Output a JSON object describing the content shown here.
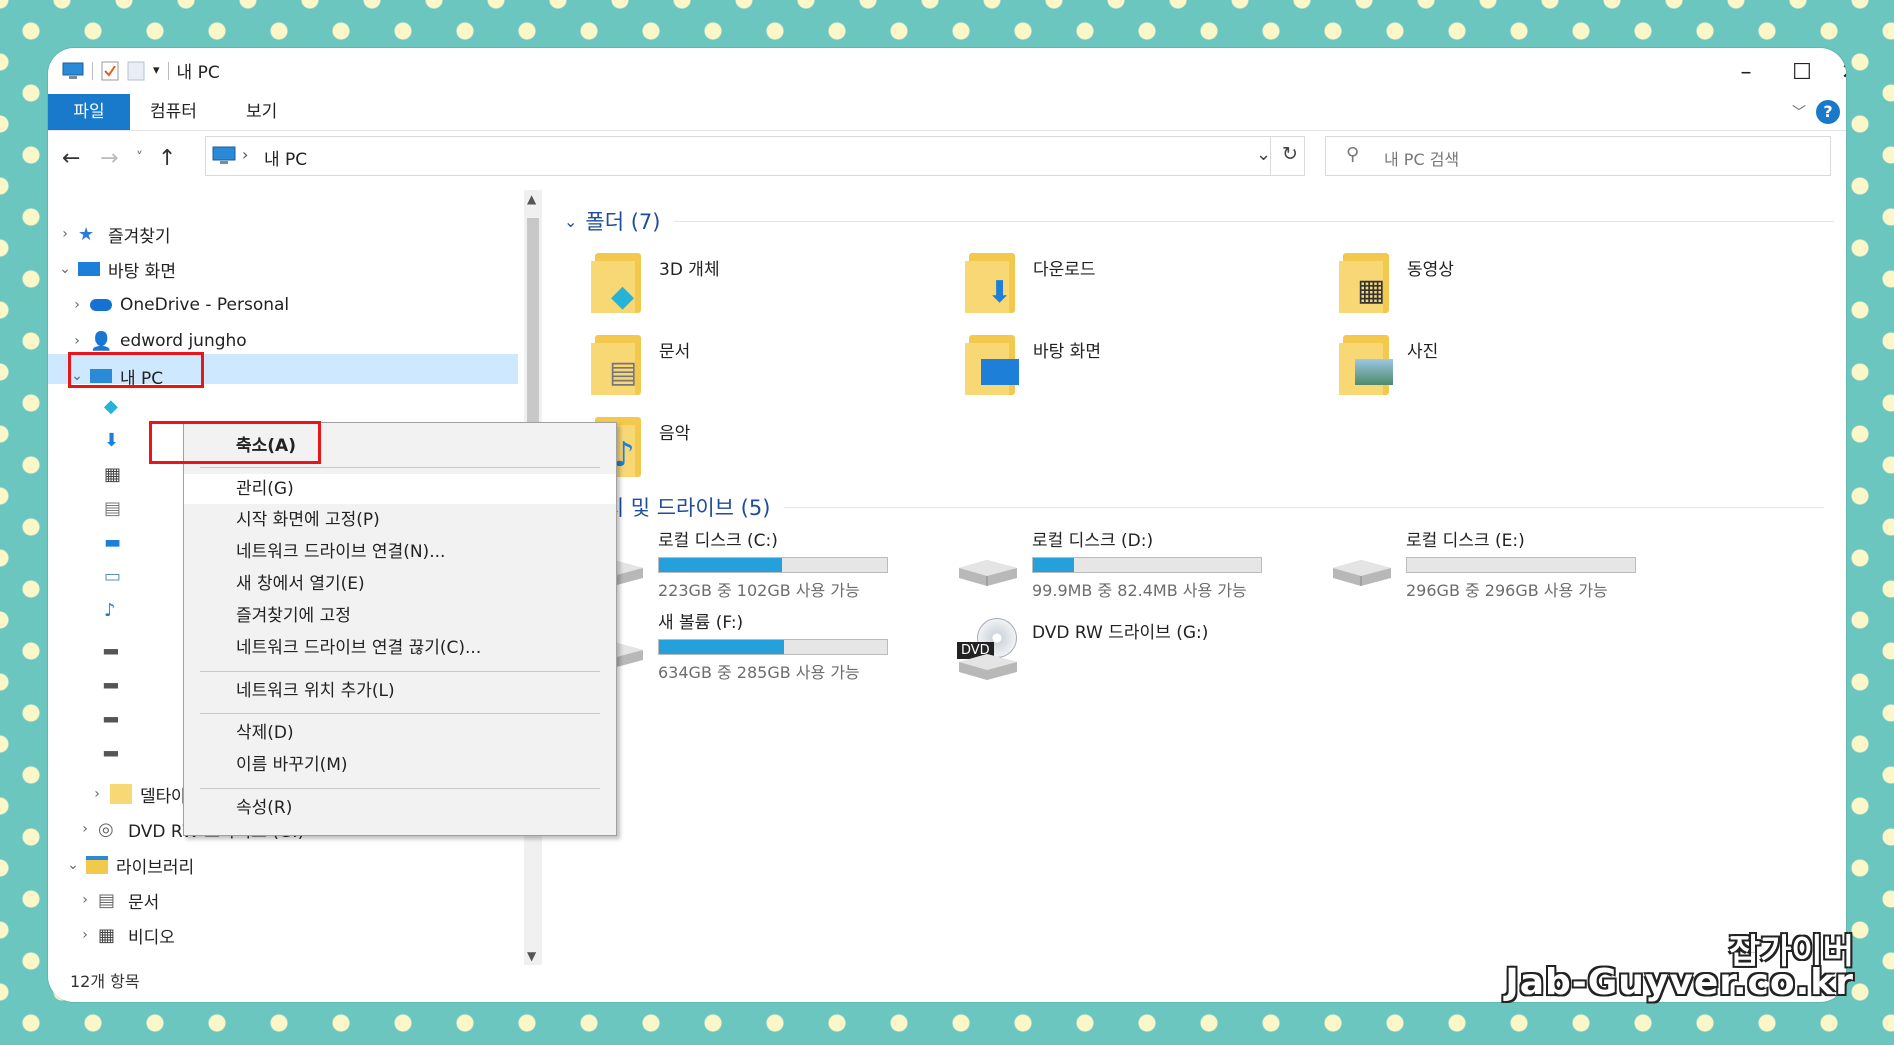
{
  "window": {
    "title": "내 PC"
  },
  "ribbon": {
    "tabs": [
      "파일",
      "컴퓨터",
      "보기"
    ]
  },
  "nav": {
    "address": "내 PC",
    "search_placeholder": "내 PC 검색"
  },
  "tree": {
    "top_items": [
      {
        "label": "즐겨찾기",
        "expanded": false
      },
      {
        "label": "바탕 화면",
        "expanded": true
      },
      {
        "label": "OneDrive - Personal",
        "expanded": false
      },
      {
        "label": "edword jungho",
        "expanded": false
      },
      {
        "label": "내 PC",
        "expanded": true
      }
    ],
    "bottom_items": [
      {
        "label": "델타아이티"
      },
      {
        "label": "DVD RW 드라이브 (G:)"
      },
      {
        "label": "라이브러리"
      },
      {
        "label": "문서"
      },
      {
        "label": "비디오"
      }
    ]
  },
  "status": {
    "count": "12개 항목"
  },
  "folders": {
    "header": "폴더 (7)",
    "items": [
      "3D 개체",
      "다운로드",
      "동영상",
      "문서",
      "바탕 화면",
      "사진",
      "음악"
    ]
  },
  "drives": {
    "header": "장치 및 드라이브 (5)",
    "items": [
      {
        "name": "로컬 디스크 (C:)",
        "free": "223GB 중 102GB 사용 가능",
        "used_fraction": 0.54
      },
      {
        "name": "로컬 디스크 (D:)",
        "free": "99.9MB 중 82.4MB 사용 가능",
        "used_fraction": 0.18
      },
      {
        "name": "로컬 디스크 (E:)",
        "free": "296GB 중 296GB 사용 가능",
        "used_fraction": 0.0
      },
      {
        "name": "새 볼륨 (F:)",
        "free": "634GB 중 285GB 사용 가능",
        "used_fraction": 0.55
      },
      {
        "name": "DVD RW 드라이브 (G:)",
        "free": "",
        "used_fraction": null
      }
    ],
    "dvd_badge": "DVD"
  },
  "context_menu": {
    "items": [
      "축소(A)",
      "관리(G)",
      "시작 화면에 고정(P)",
      "네트워크 드라이브 연결(N)...",
      "새 창에서 열기(E)",
      "즐겨찾기에 고정",
      "네트워크 드라이브 연결 끊기(C)...",
      "네트워크 위치 추가(L)",
      "삭제(D)",
      "이름 바꾸기(M)",
      "속성(R)"
    ]
  },
  "watermark": {
    "line1": "잡가이버",
    "line2": "Jab-Guyver.co.kr"
  },
  "colors": {
    "accent": "#1979ca",
    "highlight": "#e8151a",
    "selection": "#cde8ff",
    "bar_fill": "#26a0da",
    "background": "#6cc6c0"
  }
}
